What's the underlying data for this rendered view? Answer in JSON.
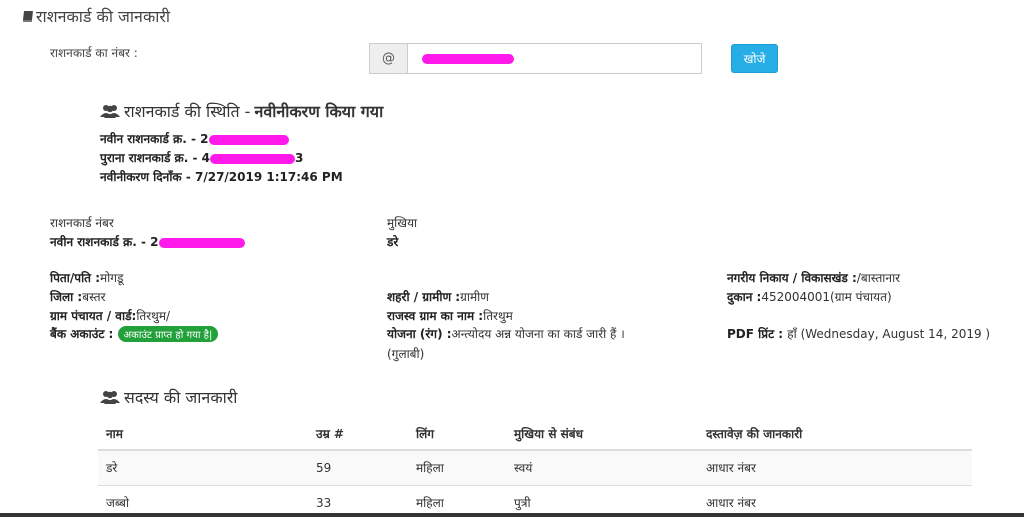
{
  "page": {
    "title": "राशनकार्ड की जानकारी"
  },
  "search": {
    "label": "राशनकार्ड का नंबर :",
    "addon": "@",
    "button_label": "खोजे"
  },
  "status": {
    "heading_label": "राशनकार्ड की स्थिति - ",
    "heading_value": "नवीनीकरण किया गया",
    "new_card_label": "नवीन राशनकार्ड क्र. - 2",
    "old_card_label": "पुराना राशनकार्ड क्र. - 4",
    "old_card_tail": "3",
    "renewal_date": "नवीनीकरण दिनाँक - 7/27/2019 1:17:46 PM"
  },
  "details": {
    "card_number_label": "राशनकार्ड नंबर",
    "card_number_value": "नवीन राशनकार्ड क्र. - 2",
    "head_label": "मुखिया",
    "head_value": "डरे",
    "father_husband_label": "पिता/पति :",
    "father_husband_value": "मोगडू",
    "district_label": "जिला :",
    "district_value": "बस्तर",
    "panchayat_label": "ग्राम पंचायत / वार्ड:",
    "panchayat_value": "तिरथुम/",
    "bank_label": "बैंक अकाउंट : ",
    "bank_badge": "अकाउंट प्राप्त हो गया है|",
    "urban_rural_label": "शहरी / ग्रामीण :",
    "urban_rural_value": "ग्रामीण",
    "revenue_village_label": "राजस्व ग्राम का नाम :",
    "revenue_village_value": "तिरथुम",
    "scheme_label": "योजना (रंग) :",
    "scheme_value": "अन्त्योदय अन्न योजना का कार्ड जारी हैं ।",
    "scheme_color": "(गुलाबी)",
    "body_label": "नगरीय निकाय / विकासखंड :",
    "body_value": "/बास्तानार",
    "shop_label": "दुकान :",
    "shop_value": "452004001(ग्राम पंचायत)",
    "pdf_label": "PDF प्रिंट : ",
    "pdf_value": "हाँ (Wednesday, August 14, 2019 )"
  },
  "members": {
    "heading": "सदस्य की जानकारी",
    "columns": [
      "नाम",
      "उम्र #",
      "लिंग",
      "मुखिया से संबंध",
      "दस्तावेज़ की जानकारी"
    ],
    "rows": [
      [
        "डरे",
        "59",
        "महिला",
        "स्वयं",
        "आधार नंबर"
      ],
      [
        "जब्बो",
        "33",
        "महिला",
        "पुत्री",
        "आधार नंबर"
      ]
    ]
  },
  "colors": {
    "redaction": "#ff19ea",
    "button": "#27aee6",
    "badge": "#22a03a"
  }
}
